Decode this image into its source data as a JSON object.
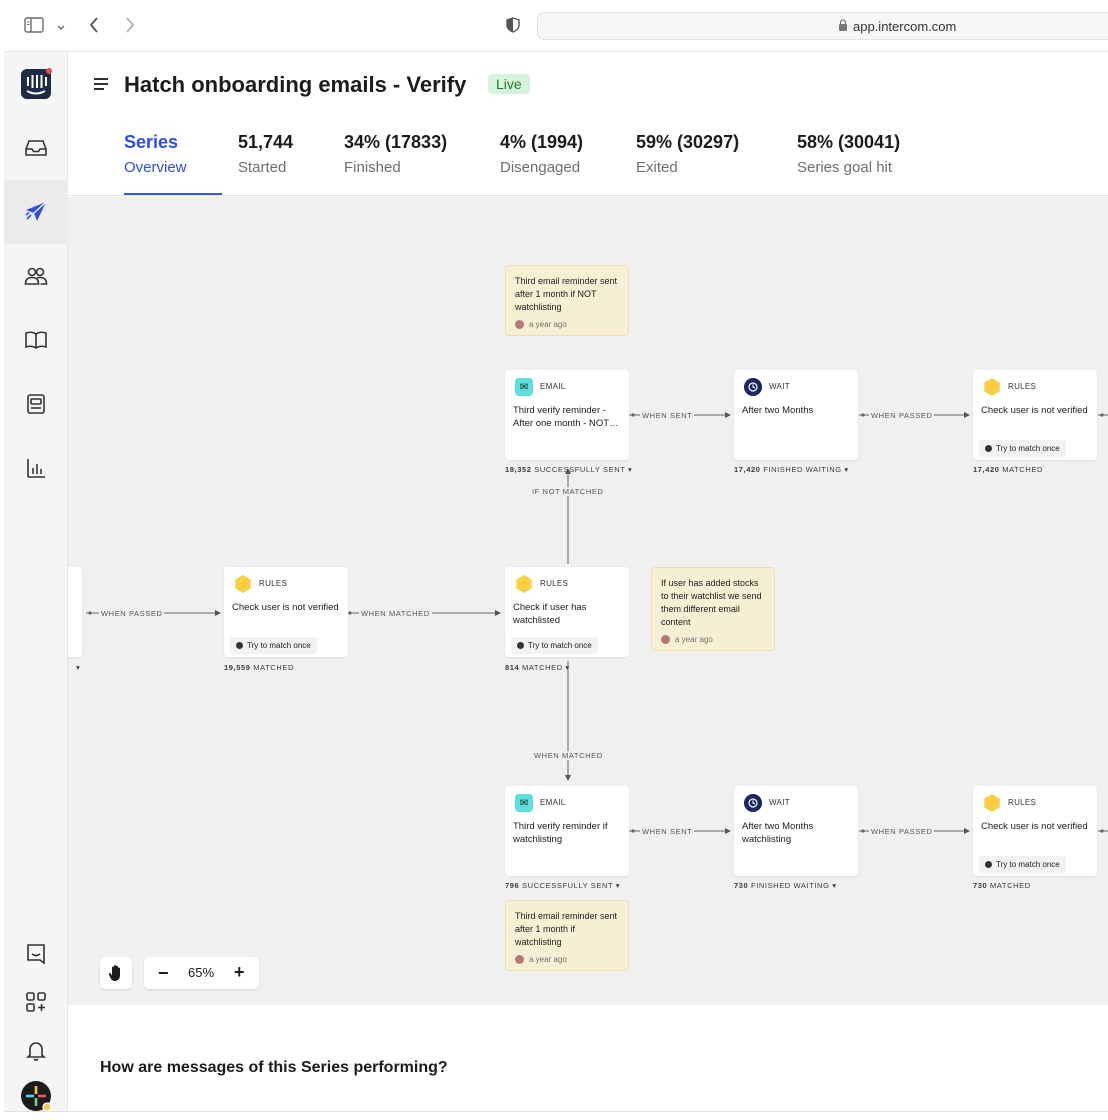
{
  "browser": {
    "url": "app.intercom.com"
  },
  "header": {
    "title": "Hatch onboarding emails - Verify",
    "status": "Live",
    "stats": [
      {
        "value": "Series",
        "label": "Overview"
      },
      {
        "value": "51,744",
        "label": "Started"
      },
      {
        "value": "34% (17833)",
        "label": "Finished"
      },
      {
        "value": "4% (1994)",
        "label": "Disengaged"
      },
      {
        "value": "59% (30297)",
        "label": "Exited"
      },
      {
        "value": "58% (30041)",
        "label": "Series goal hit"
      }
    ]
  },
  "canvas": {
    "nodes": {
      "rules_check_verified": {
        "type": "RULES",
        "title": "Check user is not verified",
        "chip": "Try to match once",
        "count": "19,559",
        "count_label": "MATCHED"
      },
      "rules_watchlisted": {
        "type": "RULES",
        "title": "Check if user has watchlisted",
        "chip": "Try to match once",
        "count": "814",
        "count_label": "MATCHED"
      },
      "email_top": {
        "type": "EMAIL",
        "title": "Third verify reminder - After one month - NOT…",
        "count": "18,352",
        "count_label": "SUCCESSFULLY SENT"
      },
      "wait_top": {
        "type": "WAIT",
        "title": "After two Months",
        "count": "17,420",
        "count_label": "FINISHED WAITING"
      },
      "rules_top": {
        "type": "RULES",
        "title": "Check user is not verified",
        "chip": "Try to match once",
        "count": "17,420",
        "count_label": "MATCHED"
      },
      "email_bottom": {
        "type": "EMAIL",
        "title": "Third verify reminder if watchlisting",
        "count": "796",
        "count_label": "SUCCESSFULLY SENT"
      },
      "wait_bottom": {
        "type": "WAIT",
        "title": "After two Months watchlisting",
        "count": "730",
        "count_label": "FINISHED WAITING"
      },
      "rules_bottom": {
        "type": "RULES",
        "title": "Check user is not verified",
        "chip": "Try to match once",
        "count": "730",
        "count_label": "MATCHED"
      }
    },
    "edges": {
      "when_passed": "WHEN PASSED",
      "when_matched": "WHEN MATCHED",
      "when_sent": "WHEN SENT",
      "if_not_matched": "IF NOT MATCHED"
    },
    "notes": [
      {
        "text": "Third email reminder sent after 1 month if NOT watchlisting",
        "time": "a year ago"
      },
      {
        "text": "If user has added stocks to their watchlist we send them different email content",
        "time": "a year ago"
      },
      {
        "text": "Third email reminder sent after 1 month if watchlisting",
        "time": "a year ago"
      }
    ]
  },
  "zoom": {
    "level": "65%",
    "minus": "−",
    "plus": "+"
  },
  "bottom": {
    "heading": "How are messages of this Series performing?"
  },
  "colors": {
    "accent": "#2f4de0",
    "live_badge_bg": "#d7f3dc",
    "note_bg": "#f6efd3",
    "email_icon": "#5de0dc",
    "rules_icon": "#f7d04a",
    "wait_icon": "#1d2561"
  }
}
